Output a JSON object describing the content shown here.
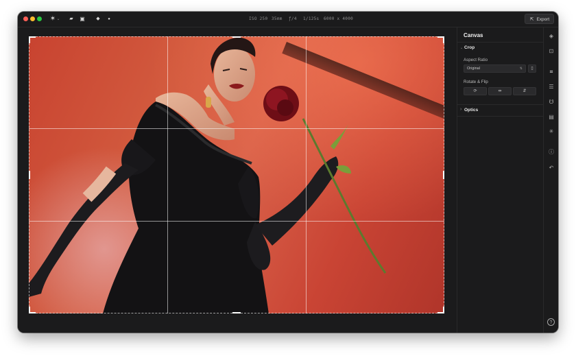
{
  "toolbar": {
    "tools": [
      {
        "name": "magic-wand-icon",
        "glyph": "✶"
      },
      {
        "name": "folder-icon",
        "glyph": "▰"
      },
      {
        "name": "image-icon",
        "glyph": "▣"
      },
      {
        "name": "eraser-icon",
        "glyph": "◆"
      },
      {
        "name": "search-icon",
        "glyph": "●"
      }
    ]
  },
  "metadata": {
    "iso": "ISO 250",
    "focal": "35mm",
    "aperture": "ƒ/4",
    "shutter": "1/125s",
    "resolution": "6000 x 4000"
  },
  "export_label": "Export",
  "panel": {
    "title": "Canvas",
    "crop": {
      "label": "Crop",
      "aspect_ratio_label": "Aspect Ratio",
      "aspect_ratio_value": "Original",
      "rotate_flip_label": "Rotate & Flip"
    },
    "optics": {
      "label": "Optics"
    }
  },
  "icons": {
    "chevron_down": "⌄",
    "chevron_right": "›",
    "select_arrows": "⇅",
    "export": "⇱",
    "orientation": "▯",
    "rotate": "⟳",
    "flip_h": "⇹",
    "flip_v": "⇵"
  },
  "side_rail": [
    {
      "name": "color-adjust-icon",
      "glyph": "◈",
      "active": false
    },
    {
      "name": "focus-icon",
      "glyph": "⊡",
      "active": false
    },
    {
      "name": "crop-icon",
      "glyph": "⌗",
      "active": true
    },
    {
      "name": "sliders-icon",
      "glyph": "☰",
      "active": false
    },
    {
      "name": "retouch-icon",
      "glyph": "☋",
      "active": false
    },
    {
      "name": "layers-icon",
      "glyph": "▤",
      "active": false
    },
    {
      "name": "effects-icon",
      "glyph": "✳",
      "active": false
    },
    {
      "name": "info-icon",
      "glyph": "ⓘ",
      "active": false
    },
    {
      "name": "history-icon",
      "glyph": "↶",
      "active": false
    },
    {
      "name": "help-icon",
      "glyph": "?",
      "active": false
    }
  ]
}
